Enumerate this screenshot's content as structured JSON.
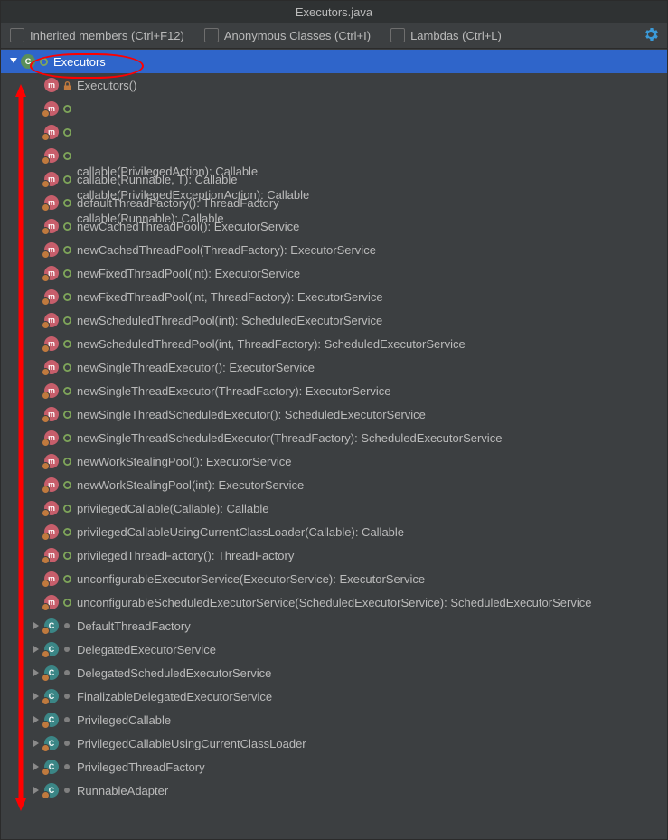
{
  "title": "Executors.java",
  "toolbar": {
    "inherited": "Inherited members (Ctrl+F12)",
    "anonymous": "Anonymous Classes (Ctrl+I)",
    "lambdas": "Lambdas (Ctrl+L)"
  },
  "root": {
    "label": "Executors"
  },
  "methods": [
    {
      "label": "Executors()",
      "vis": "private",
      "static": false
    },
    {
      "label": "callable(PrivilegedAction<?>): Callable<Object>",
      "vis": "public",
      "static": true
    },
    {
      "label": "callable(PrivilegedExceptionAction<?>): Callable<Object>",
      "vis": "public",
      "static": true
    },
    {
      "label": "callable(Runnable): Callable<Object>",
      "vis": "public",
      "static": true
    },
    {
      "label": "callable(Runnable, T): Callable<T>",
      "vis": "public",
      "static": true
    },
    {
      "label": "defaultThreadFactory(): ThreadFactory",
      "vis": "public",
      "static": true
    },
    {
      "label": "newCachedThreadPool(): ExecutorService",
      "vis": "public",
      "static": true
    },
    {
      "label": "newCachedThreadPool(ThreadFactory): ExecutorService",
      "vis": "public",
      "static": true
    },
    {
      "label": "newFixedThreadPool(int): ExecutorService",
      "vis": "public",
      "static": true
    },
    {
      "label": "newFixedThreadPool(int, ThreadFactory): ExecutorService",
      "vis": "public",
      "static": true
    },
    {
      "label": "newScheduledThreadPool(int): ScheduledExecutorService",
      "vis": "public",
      "static": true
    },
    {
      "label": "newScheduledThreadPool(int, ThreadFactory): ScheduledExecutorService",
      "vis": "public",
      "static": true
    },
    {
      "label": "newSingleThreadExecutor(): ExecutorService",
      "vis": "public",
      "static": true
    },
    {
      "label": "newSingleThreadExecutor(ThreadFactory): ExecutorService",
      "vis": "public",
      "static": true
    },
    {
      "label": "newSingleThreadScheduledExecutor(): ScheduledExecutorService",
      "vis": "public",
      "static": true
    },
    {
      "label": "newSingleThreadScheduledExecutor(ThreadFactory): ScheduledExecutorService",
      "vis": "public",
      "static": true
    },
    {
      "label": "newWorkStealingPool(): ExecutorService",
      "vis": "public",
      "static": true
    },
    {
      "label": "newWorkStealingPool(int): ExecutorService",
      "vis": "public",
      "static": true
    },
    {
      "label": "privilegedCallable(Callable<T>): Callable<T>",
      "vis": "public",
      "static": true
    },
    {
      "label": "privilegedCallableUsingCurrentClassLoader(Callable<T>): Callable<T>",
      "vis": "public",
      "static": true
    },
    {
      "label": "privilegedThreadFactory(): ThreadFactory",
      "vis": "public",
      "static": true
    },
    {
      "label": "unconfigurableExecutorService(ExecutorService): ExecutorService",
      "vis": "public",
      "static": true
    },
    {
      "label": "unconfigurableScheduledExecutorService(ScheduledExecutorService): ScheduledExecutorService",
      "vis": "public",
      "static": true
    }
  ],
  "inner": [
    {
      "label": "DefaultThreadFactory"
    },
    {
      "label": "DelegatedExecutorService"
    },
    {
      "label": "DelegatedScheduledExecutorService"
    },
    {
      "label": "FinalizableDelegatedExecutorService"
    },
    {
      "label": "PrivilegedCallable"
    },
    {
      "label": "PrivilegedCallableUsingCurrentClassLoader"
    },
    {
      "label": "PrivilegedThreadFactory"
    },
    {
      "label": "RunnableAdapter"
    }
  ]
}
